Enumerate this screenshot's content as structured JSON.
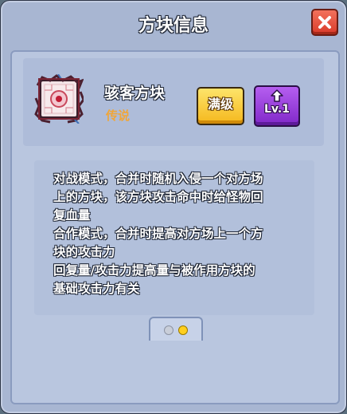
{
  "dialog": {
    "title": "方块信息",
    "close_icon": "close-icon"
  },
  "block": {
    "name": "骇客方块",
    "rarity": "传说",
    "icon": "hacker-block-icon",
    "max_button_label": "满级",
    "level_button_label": "Lv.1",
    "level_button_icon": "upgrade-arrow-icon"
  },
  "description": {
    "lines": [
      "对战模式，合并时随机入侵一个对方场",
      "上的方块，该方块攻击命中时给怪物回",
      "复血量",
      "合作模式，合并时提高对方场上一个方",
      "块的攻击力",
      "回复量/攻击力提高量与被作用方块的",
      "基础攻击力有关"
    ]
  },
  "pager": {
    "total": 2,
    "active": 2
  },
  "colors": {
    "panel": "#a8b6d2",
    "rarity_legendary": "#f0a63a",
    "max_button": "#f5b81d",
    "level_button": "#8028c8",
    "close_button": "#d93a2a"
  }
}
